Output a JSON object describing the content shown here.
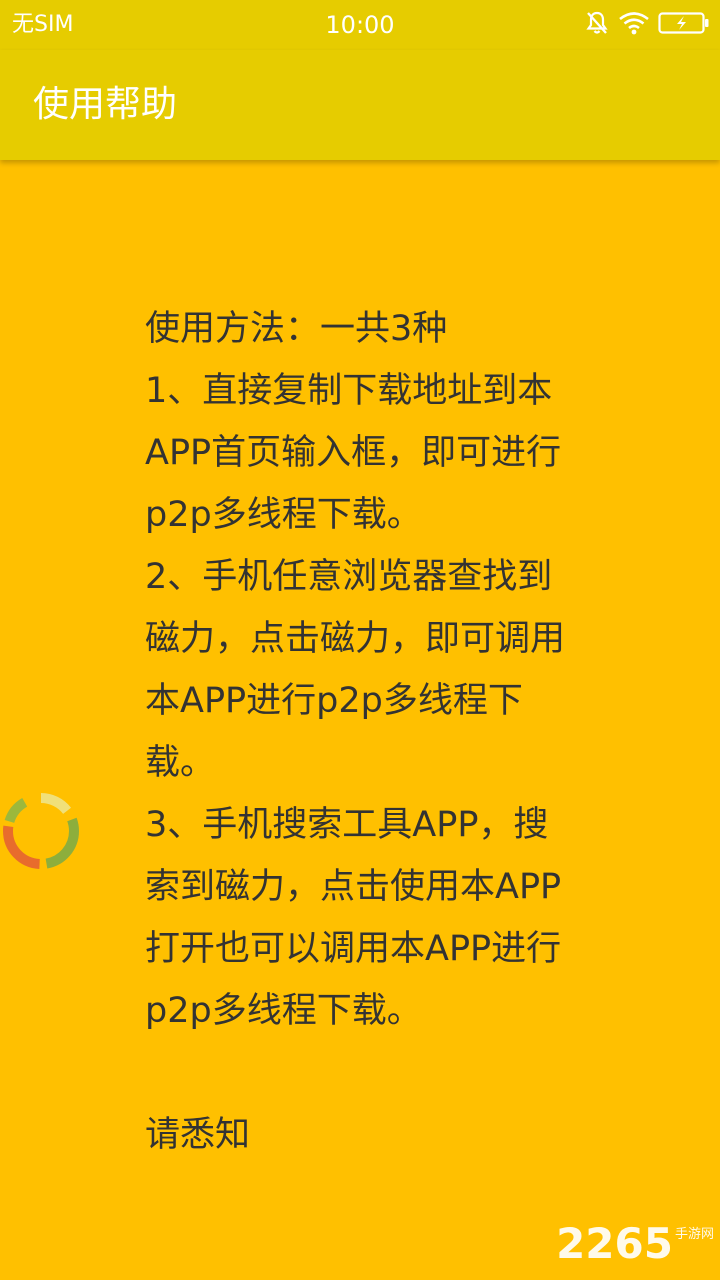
{
  "status_bar": {
    "carrier": "无SIM",
    "time": "10:00",
    "icons": [
      "alarm-off-icon",
      "wifi-icon",
      "battery-charging-icon"
    ]
  },
  "app_bar": {
    "title": "使用帮助"
  },
  "help": {
    "line_1": "使用方法：一共3种",
    "line_2": "1、直接复制下载地址到本APP首页输入框，即可进行p2p多线程下载。",
    "line_3": "2、手机任意浏览器查找到磁力，点击磁力，即可调用本APP进行p2p多线程下载。",
    "line_4": "3、手机搜索工具APP，搜索到磁力，点击使用本APP打开也可以调用本APP进行p2p多线程下载。",
    "line_5": "请悉知"
  },
  "watermark": {
    "number": "2265",
    "sub": "手游网"
  },
  "colors": {
    "bar": "#E6CC00",
    "background": "#FFC000",
    "text": "#333333"
  }
}
